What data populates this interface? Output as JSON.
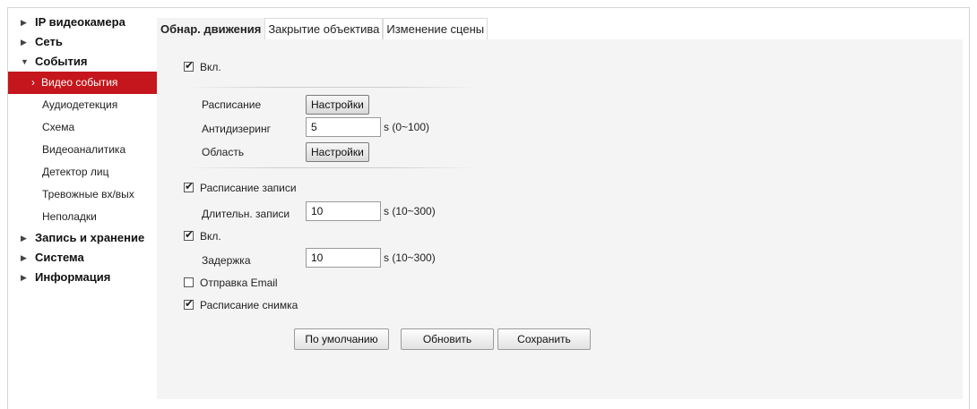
{
  "sidebar": {
    "items": [
      {
        "type": "top",
        "label": "IP видеокамера",
        "icon": "triangle-right",
        "expanded": false
      },
      {
        "type": "top",
        "label": "Сеть",
        "icon": "triangle-right",
        "expanded": false
      },
      {
        "type": "top",
        "label": "События",
        "icon": "triangle-down",
        "expanded": true
      },
      {
        "type": "sub",
        "label": "Видео события",
        "active": true
      },
      {
        "type": "sub",
        "label": "Аудиодетекция"
      },
      {
        "type": "sub",
        "label": "Схема"
      },
      {
        "type": "sub",
        "label": "Видеоаналитика"
      },
      {
        "type": "sub",
        "label": "Детектор лиц"
      },
      {
        "type": "sub",
        "label": "Тревожные вх/вых"
      },
      {
        "type": "sub",
        "label": "Неполадки"
      },
      {
        "type": "top",
        "label": "Запись и хранение",
        "icon": "triangle-right",
        "expanded": false
      },
      {
        "type": "top",
        "label": "Система",
        "icon": "triangle-right",
        "expanded": false
      },
      {
        "type": "top",
        "label": "Информация",
        "icon": "triangle-right",
        "expanded": false
      }
    ]
  },
  "tabs": [
    {
      "label": "Обнар. движения",
      "active": true
    },
    {
      "label": "Закрытие объектива",
      "active": false
    },
    {
      "label": "Изменение сцены",
      "active": false
    }
  ],
  "form": {
    "enable": {
      "label": "Вкл.",
      "checked": true
    },
    "schedule": {
      "label": "Расписание",
      "button": "Настройки"
    },
    "antidither": {
      "label": "Антидизеринг",
      "value": "5",
      "unit": "s (0~100)"
    },
    "area": {
      "label": "Область",
      "button": "Настройки"
    },
    "record_schedule": {
      "label": "Расписание записи",
      "checked": true
    },
    "record_duration": {
      "label": "Длительн. записи",
      "value": "10",
      "unit": "s (10~300)"
    },
    "alarm_out": {
      "label": "Вкл.",
      "checked": true
    },
    "delay": {
      "label": "Задержка",
      "value": "10",
      "unit": "s (10~300)"
    },
    "send_email": {
      "label": "Отправка Email",
      "checked": false
    },
    "snapshot_schedule": {
      "label": "Расписание снимка",
      "checked": true
    }
  },
  "actions": {
    "default_label": "По умолчанию",
    "refresh_label": "Обновить",
    "save_label": "Сохранить"
  },
  "colors": {
    "accent": "#c4161c",
    "panel_bg": "#f4f4f4"
  }
}
